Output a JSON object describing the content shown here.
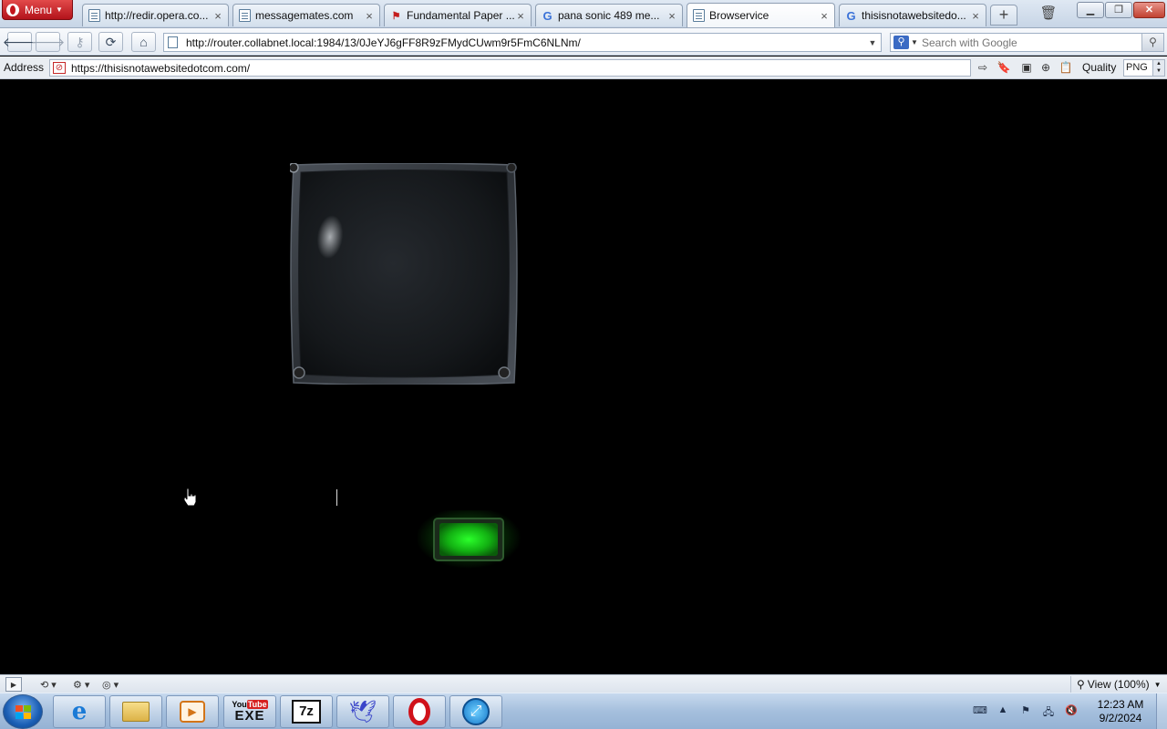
{
  "browser": {
    "menu_label": "Menu",
    "tabs": [
      {
        "label": "http://redir.opera.co...",
        "favicon": "page-icon",
        "active": false
      },
      {
        "label": "messagemates.com",
        "favicon": "page-icon",
        "active": false
      },
      {
        "label": "Fundamental Paper ...",
        "favicon": "pdf-icon",
        "active": false
      },
      {
        "label": "pana sonic 489 me...",
        "favicon": "google-icon",
        "active": false
      },
      {
        "label": "Browservice",
        "favicon": "page-icon",
        "active": true
      },
      {
        "label": "thisisnotawebsitedo...",
        "favicon": "google-icon",
        "active": false
      }
    ],
    "tab_close_glyph": "×",
    "url": "http://router.collabnet.local:1984/13/0JeYJ6gFF8R9zFMydCUwm9r5FmC6NLNm/",
    "search_placeholder": "Search with Google"
  },
  "addressbar": {
    "label": "Address",
    "url": "https://thisisnotawebsitedotcom.com/",
    "quality_label": "Quality",
    "quality_value": "PNG"
  },
  "statusbar": {
    "zoom_label": "View (100%)"
  },
  "taskbar": {
    "clock_time": "12:23 AM",
    "clock_date": "9/2/2024",
    "apps": [
      "internet-explorer",
      "file-explorer",
      "media-player",
      "youtube-exe",
      "7zip",
      "bird-app",
      "opera",
      "safari"
    ],
    "youtube_label": "You",
    "youtube_box": "Tube",
    "exe_label": "EXE",
    "sevenzip_label": "7z"
  },
  "colors": {
    "page_background": "#000000",
    "power_button_glow": "#1ed21e",
    "active_tab": "#ffffff",
    "menu_button": "#c3141c"
  }
}
